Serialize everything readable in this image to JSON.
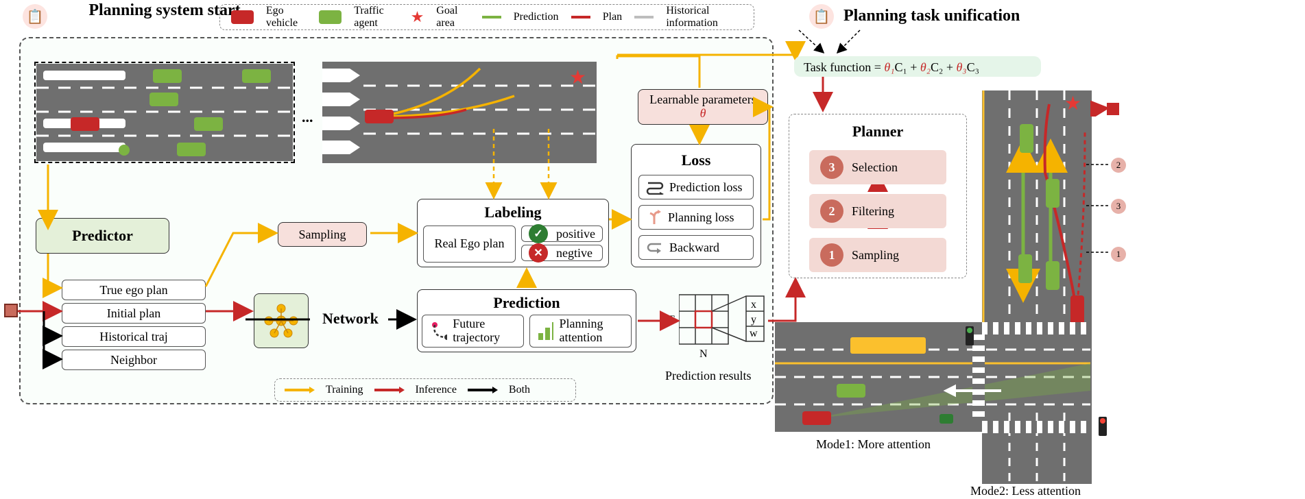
{
  "titles": {
    "start": "Planning system start",
    "unification": "Planning task unification"
  },
  "legend_top": {
    "ego": "Ego vehicle",
    "agent": "Traffic agent",
    "goal": "Goal area",
    "prediction": "Prediction",
    "plan": "Plan",
    "hist": "Historical information"
  },
  "legend_bottom": {
    "training": "Training",
    "inference": "Inference",
    "both": "Both"
  },
  "predictor": "Predictor",
  "sampling": "Sampling",
  "inputs": {
    "true_plan": "True ego plan",
    "initial_plan": "Initial plan",
    "hist_traj": "Historical traj",
    "neighbor": "Neighbor"
  },
  "network": "Network",
  "labeling": {
    "title": "Labeling",
    "real_plan": "Real Ego plan",
    "positive": "positive",
    "negative": "negtive"
  },
  "prediction": {
    "title": "Prediction",
    "future_traj": "Future trajectory",
    "planning_attention": "Planning attention"
  },
  "loss": {
    "title": "Loss",
    "prediction_loss": "Prediction loss",
    "planning_loss": "Planning loss",
    "backward": "Backward"
  },
  "learnable": "Learnable parameters",
  "theta": "θ",
  "pred_results": {
    "label": "Prediction results",
    "T": "T",
    "N": "N",
    "x": "x",
    "y": "y",
    "w": "w"
  },
  "task_fn": {
    "prefix": "Task function = ",
    "t1": "θ₁",
    "c1": "C₁",
    "t2": "θ₂",
    "c2": "C₂",
    "t3": "θ₃",
    "c3": "C₃"
  },
  "planner": {
    "title": "Planner",
    "step3": "Selection",
    "step2": "Filtering",
    "step1": "Sampling"
  },
  "candidates": {
    "one": "1",
    "two": "2",
    "three": "3"
  },
  "modes": {
    "mode1": "Mode1: More attention",
    "mode2": "Mode2: Less attention"
  },
  "ellipsis": "..."
}
